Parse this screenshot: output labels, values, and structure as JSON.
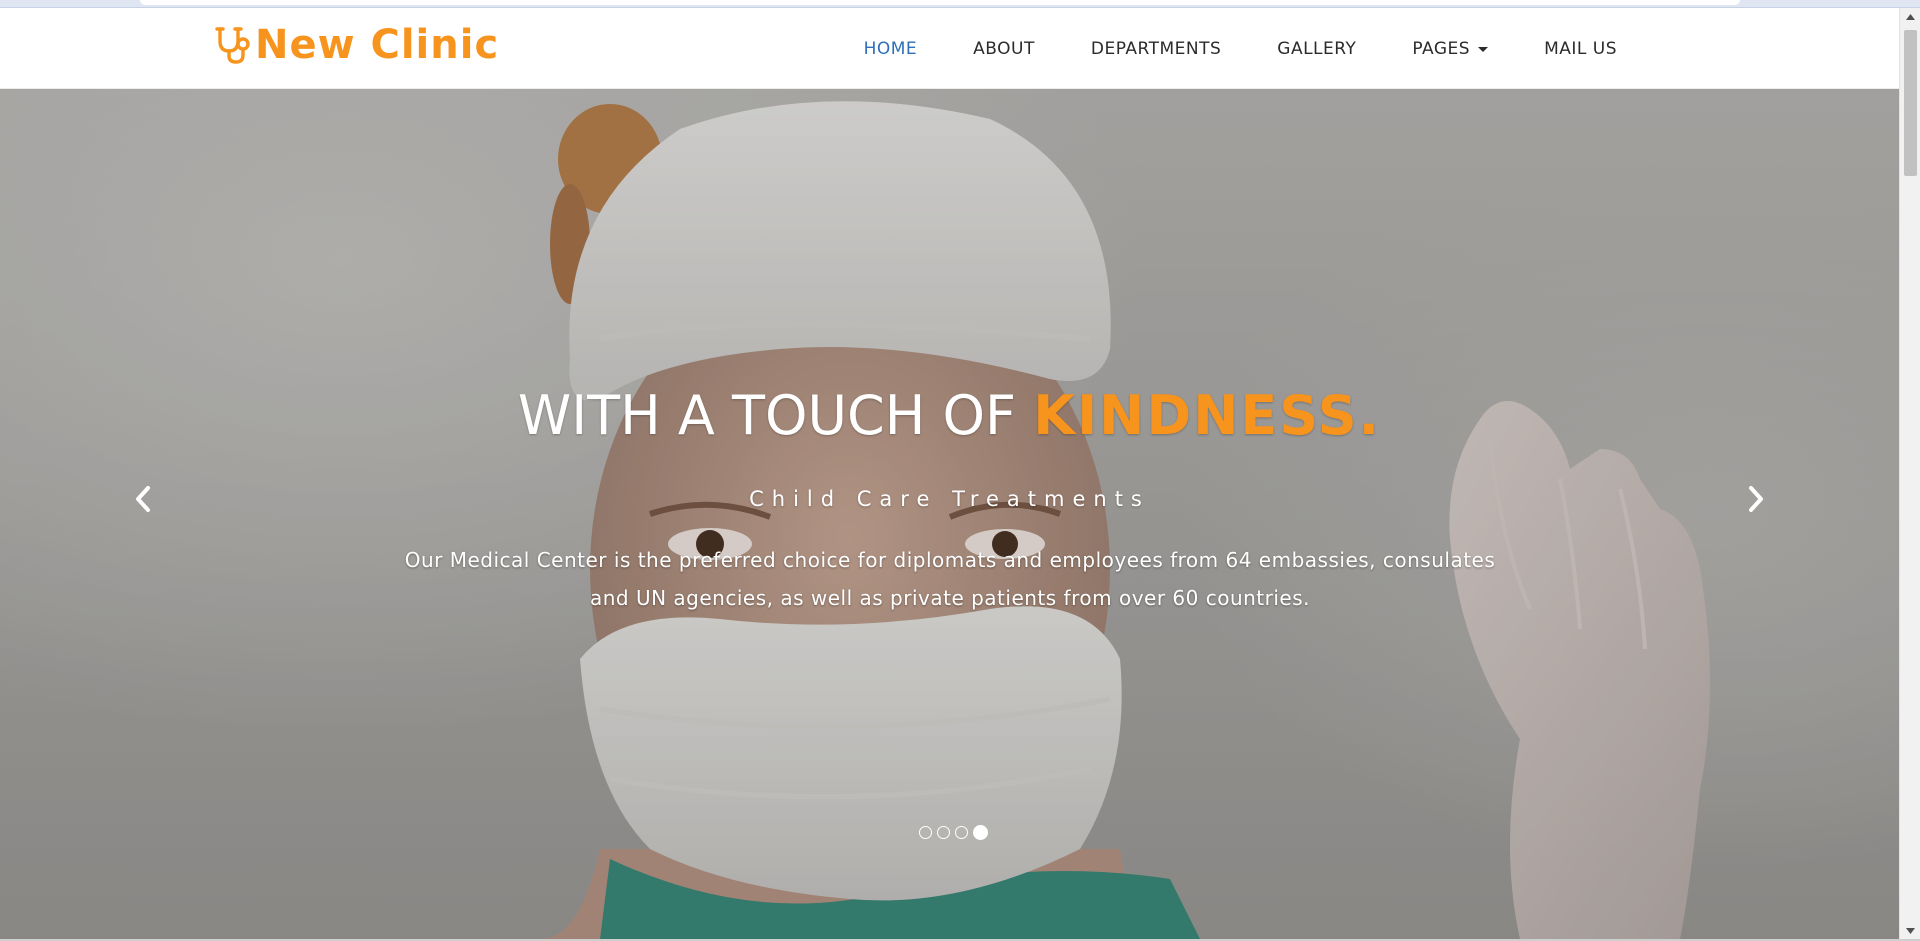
{
  "brand": {
    "name": "New Clinic",
    "color": "#f7941d",
    "icon": "stethoscope-icon"
  },
  "nav": {
    "items": [
      {
        "label": "HOME",
        "active": true
      },
      {
        "label": "ABOUT"
      },
      {
        "label": "DEPARTMENTS"
      },
      {
        "label": "GALLERY"
      },
      {
        "label": "PAGES",
        "dropdown": true
      },
      {
        "label": "MAIL US"
      }
    ],
    "active_color": "#2e6fb7"
  },
  "hero": {
    "headline_prefix": "WITH A TOUCH OF ",
    "headline_accent": "KINDNESS.",
    "subheadline": "Child Care Treatments",
    "description": "Our Medical Center is the preferred choice for diplomats and employees from 64 embassies, consulates and UN agencies, as well as private patients from over 60 countries.",
    "prev_icon": "chevron-left-icon",
    "next_icon": "chevron-right-icon",
    "slides": {
      "total": 4,
      "active_index": 3
    }
  }
}
